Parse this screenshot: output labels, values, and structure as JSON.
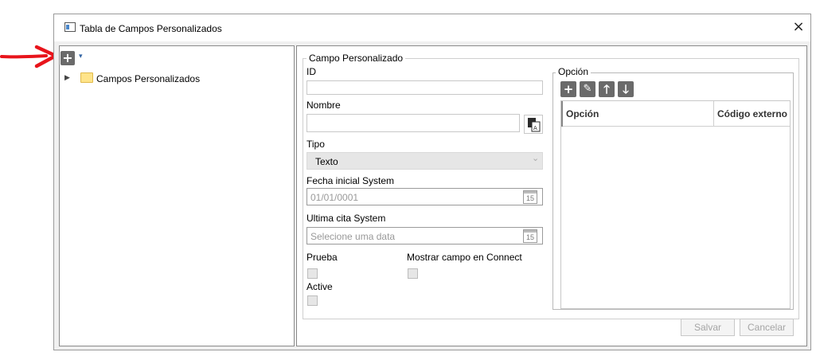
{
  "window": {
    "title": "Tabla de Campos Personalizados",
    "close_icon": "×"
  },
  "tree": {
    "add_icon": "+",
    "dropdown_icon": "▾",
    "expander_icon": "▶",
    "root_label": "Campos Personalizados"
  },
  "form": {
    "group_title": "Campo Personalizado",
    "id_label": "ID",
    "id_value": "",
    "nombre_label": "Nombre",
    "nombre_value": "",
    "tipo_label": "Tipo",
    "tipo_value": "Texto",
    "tipo_chevron": "⌄",
    "fecha_label": "Fecha inicial System",
    "fecha_value": "01/01/0001",
    "ultima_label": "Ultima cita System",
    "ultima_placeholder": "Selecione uma data",
    "calendar_day": "15",
    "prueba_label": "Prueba",
    "active_label": "Active",
    "connect_label": "Mostrar campo en Connect"
  },
  "opcion": {
    "group_title": "Opción",
    "tool_add": "+",
    "tool_edit": "✎",
    "tool_up": "🡑",
    "tool_down": "🡓",
    "columns": [
      "Opción",
      "Código externo"
    ]
  },
  "buttons": {
    "save": "Salvar",
    "cancel": "Cancelar"
  },
  "annotation": {
    "arrow_color": "#e8141b"
  }
}
